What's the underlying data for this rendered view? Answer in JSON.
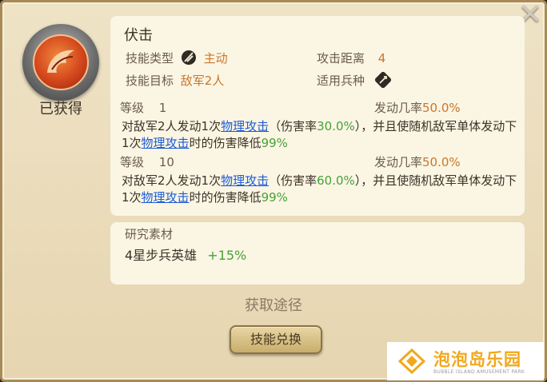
{
  "skill": {
    "name": "伏击",
    "status": "已获得",
    "type_label": "技能类型",
    "type_icon": "slash-attack-icon",
    "type_value": "主动",
    "range_label": "攻击距离",
    "range_value": "4",
    "target_label": "技能目标",
    "target_value": "敌军2人",
    "troop_label": "适用兵种",
    "troop_icon": "sword-icon"
  },
  "levels": [
    {
      "level_label": "等级",
      "level_value": "1",
      "trigger_label": "发动几率",
      "trigger_value": "50.0%",
      "desc_part1": "对敌军2人发动1次",
      "desc_link1": "物理攻击",
      "desc_part2": "（伤害率",
      "desc_rate": "30.0%",
      "desc_part3": "），并且使随机敌军单体发动下1次",
      "desc_link2": "物理攻击",
      "desc_part4": "时的伤害降低",
      "desc_reduce": "99%"
    },
    {
      "level_label": "等级",
      "level_value": "10",
      "trigger_label": "发动几率",
      "trigger_value": "50.0%",
      "desc_part1": "对敌军2人发动1次",
      "desc_link1": "物理攻击",
      "desc_part2": "（伤害率",
      "desc_rate": "60.0%",
      "desc_part3": "），并且使随机敌军单体发动下1次",
      "desc_link2": "物理攻击",
      "desc_part4": "时的伤害降低",
      "desc_reduce": "99%"
    }
  ],
  "research": {
    "title": "研究素材",
    "item": "4星步兵英雄",
    "bonus": "+15%"
  },
  "acquire_label": "获取途径",
  "exchange_button": "技能兑换",
  "watermark": {
    "title": "泡泡岛乐园",
    "subtitle": "BUBBLE ISLAND AMUSEMENT PARK"
  },
  "colors": {
    "accent_orange": "#c9772a",
    "highlight_green": "#46a337",
    "link_blue": "#1c5cd6",
    "panel_bg": "#fbf5e4"
  },
  "icons": {
    "close": "close-icon",
    "skill": "ambush-skill-icon",
    "watermark_logo": "bubble-island-logo-icon"
  }
}
